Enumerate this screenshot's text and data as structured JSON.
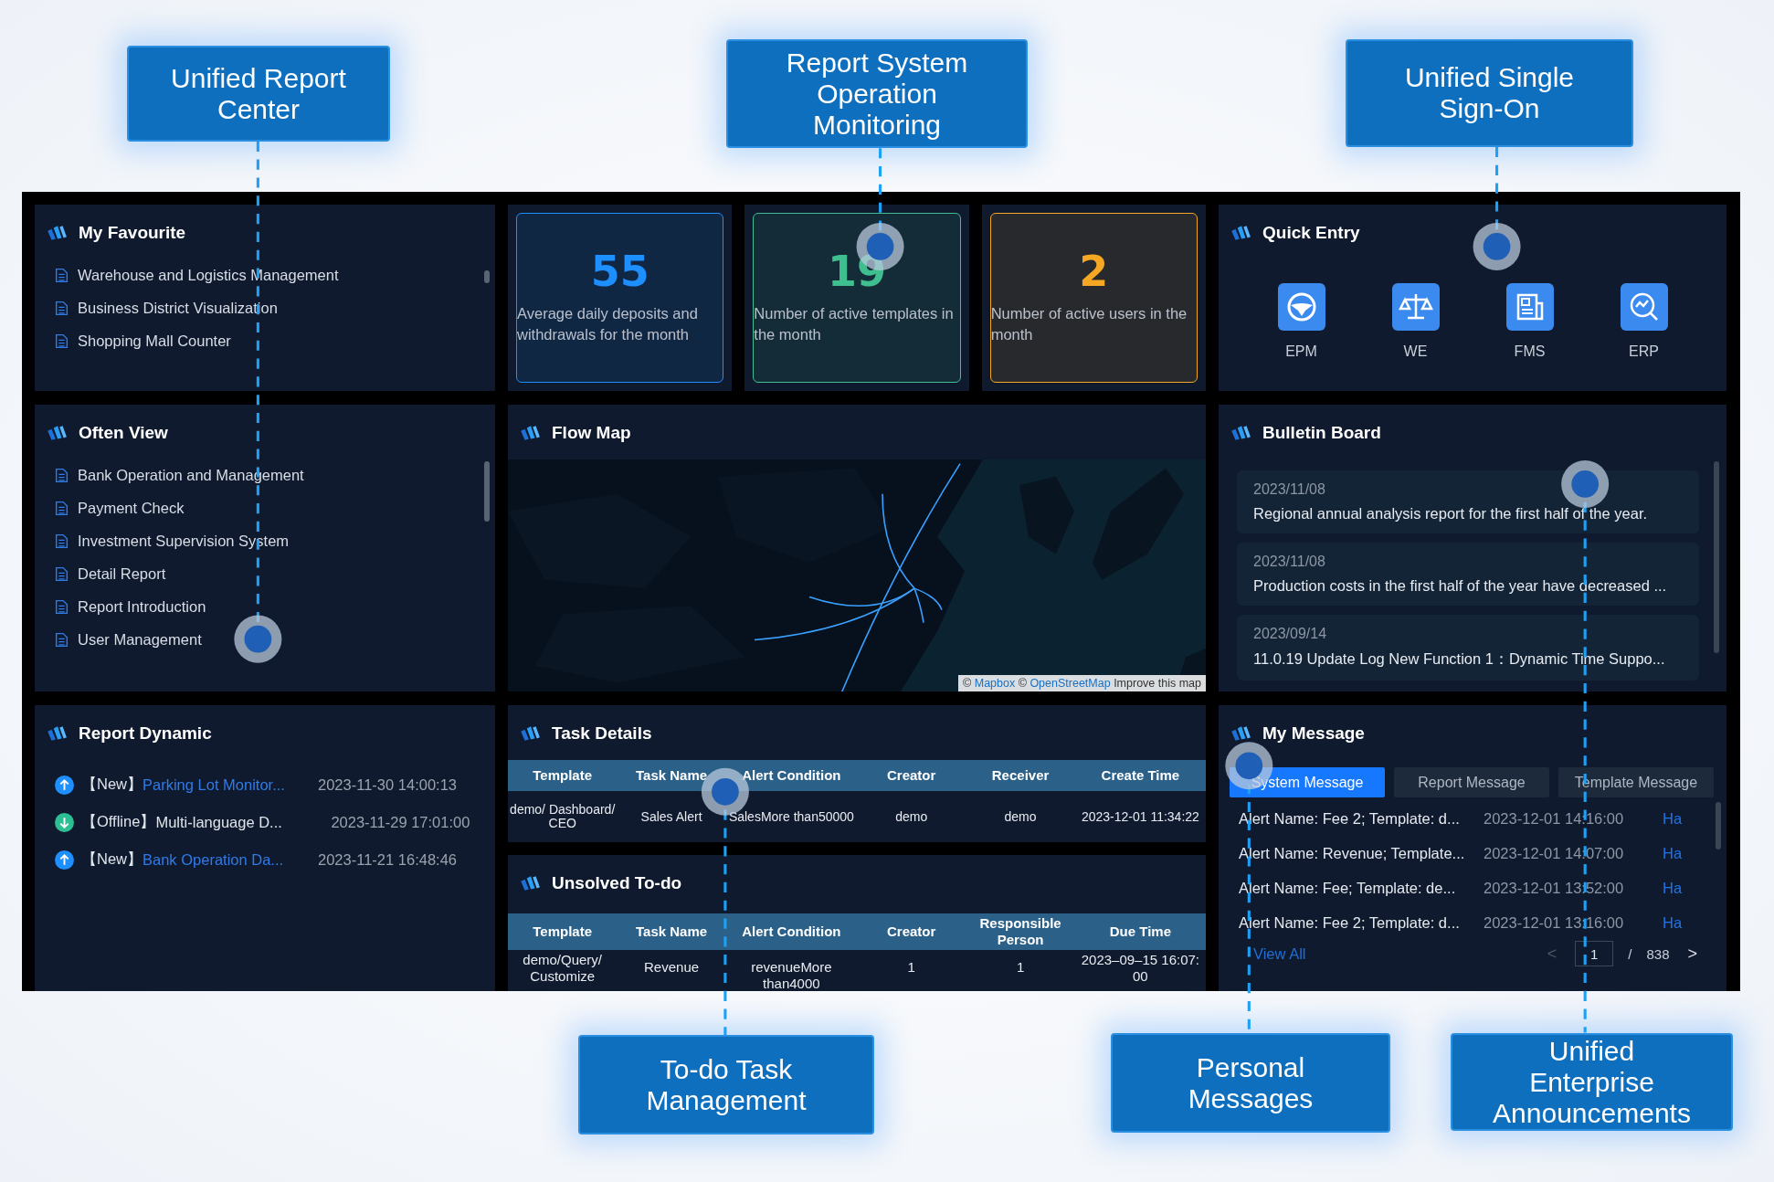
{
  "callouts_top": [
    {
      "label": "Unified Report Center"
    },
    {
      "label": "Report System Operation Monitoring"
    },
    {
      "label": "Unified Single Sign-On"
    }
  ],
  "callouts_bottom": [
    {
      "label": "To-do Task Management"
    },
    {
      "label": "Personal Messages"
    },
    {
      "label": "Unified Enterprise Announcements"
    }
  ],
  "favourites": {
    "title": "My Favourite",
    "items": [
      "Warehouse and Logistics Management",
      "Business District Visualization",
      "Shopping Mall Counter"
    ]
  },
  "stats": [
    {
      "value": "55",
      "caption": "Average daily deposits and withdrawals for the month",
      "color": "#1e8fff"
    },
    {
      "value": "19",
      "caption": "Number of active templates in the month",
      "color": "#3fbf8f"
    },
    {
      "value": "2",
      "caption": "Number of active users in the month",
      "color": "#f5a623"
    }
  ],
  "quick_entry": {
    "title": "Quick Entry",
    "items": [
      {
        "label": "EPM"
      },
      {
        "label": "WE"
      },
      {
        "label": "FMS"
      },
      {
        "label": "ERP"
      }
    ]
  },
  "often_view": {
    "title": "Often View",
    "items": [
      "Bank Operation and Management",
      "Payment Check",
      "Investment Supervision System",
      "Detail Report",
      "Report Introduction",
      "User Management"
    ]
  },
  "flow_map": {
    "title": "Flow Map",
    "attribution": {
      "sign": "©",
      "link_1": "Mapbox",
      "sign_2": "©",
      "link_2": "OpenStreetMap",
      "link_3": "Improve this map"
    }
  },
  "bulletin": {
    "title": "Bulletin Board",
    "items": [
      {
        "date": "2023/11/08",
        "text": "Regional annual analysis report for the first half of the year."
      },
      {
        "date": "2023/11/08",
        "text": "Production costs in the first half of the year have decreased ..."
      },
      {
        "date": "2023/09/14",
        "text": "11.0.19 Update Log New Function 1：Dynamic Time Suppo..."
      }
    ]
  },
  "report_dynamic": {
    "title": "Report Dynamic",
    "items": [
      {
        "kind": "new",
        "tag": "【New】",
        "title": "Parking Lot Monitor...",
        "time": "2023-11-30 14:00:13"
      },
      {
        "kind": "offline",
        "tag": "【Offline】",
        "title": "Multi-language D...",
        "time": "2023-11-29 17:01:00"
      },
      {
        "kind": "new",
        "tag": "【New】",
        "title": "Bank Operation Da...",
        "time": "2023-11-21 16:48:46"
      }
    ]
  },
  "task_details": {
    "title": "Task Details",
    "columns": [
      "Template",
      "Task Name",
      "Alert Condition",
      "Creator",
      "Receiver",
      "Create Time"
    ],
    "rows": [
      [
        "demo/ Dashboard/ CEO",
        "Sales Alert",
        "SalesMore than50000",
        "demo",
        "demo",
        "2023-12-01 11:34:22"
      ]
    ]
  },
  "unsolved_todo": {
    "title": "Unsolved To-do",
    "columns": [
      "Template",
      "Task Name",
      "Alert Condition",
      "Creator",
      "Responsible Person",
      "Due Time"
    ],
    "rows": [
      [
        "demo/Query/ Customize",
        "Revenue",
        "revenueMore than4000",
        "1",
        "1",
        "2023–09–15 16:07: 00"
      ]
    ]
  },
  "my_message": {
    "title": "My Message",
    "tabs": [
      {
        "label": "System Message",
        "selected": true
      },
      {
        "label": "Report Message",
        "selected": false
      },
      {
        "label": "Template Message",
        "selected": false
      }
    ],
    "rows": [
      {
        "text": "Alert Name: Fee 2; Template: d...",
        "time": "2023-12-01 14:16:00",
        "action": "Ha"
      },
      {
        "text": "Alert Name: Revenue; Template...",
        "time": "2023-12-01 14:07:00",
        "action": "Ha"
      },
      {
        "text": "Alert Name: Fee; Template: de...",
        "time": "2023-12-01 13:52:00",
        "action": "Ha"
      },
      {
        "text": "Alert Name: Fee 2; Template: d...",
        "time": "2023-12-01 13:16:00",
        "action": "Ha"
      }
    ],
    "view_all": "View All",
    "pagination": {
      "prev": {
        "label": "<",
        "disabled": true
      },
      "page": "1",
      "separator": "/",
      "total": "838",
      "next": {
        "label": ">",
        "disabled": false
      }
    }
  }
}
